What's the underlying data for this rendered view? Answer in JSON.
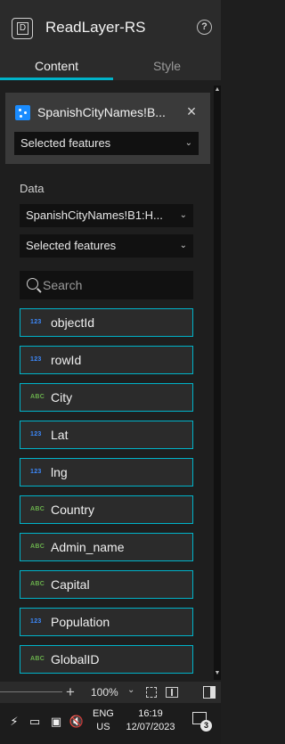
{
  "header": {
    "title": "ReadLayer-RS",
    "logo_letter": "D",
    "help_glyph": "?"
  },
  "tabs": [
    {
      "label": "Content",
      "active": true
    },
    {
      "label": "Style",
      "active": false
    }
  ],
  "layer_card": {
    "name": "SpanishCityNames!B...",
    "close_glyph": "×",
    "selection": "Selected features"
  },
  "data_section": {
    "label": "Data",
    "source": "SpanishCityNames!B1:H...",
    "selection": "Selected features",
    "search_placeholder": "Search"
  },
  "fields": [
    {
      "type": "123",
      "name": "objectId"
    },
    {
      "type": "123",
      "name": "rowId"
    },
    {
      "type": "ABC",
      "name": "City"
    },
    {
      "type": "123",
      "name": "Lat"
    },
    {
      "type": "123",
      "name": "lng"
    },
    {
      "type": "ABC",
      "name": "Country"
    },
    {
      "type": "ABC",
      "name": "Admin_name"
    },
    {
      "type": "ABC",
      "name": "Capital"
    },
    {
      "type": "123",
      "name": "Population"
    },
    {
      "type": "ABC",
      "name": "GlobalID"
    }
  ],
  "zoom": {
    "level": "100%",
    "plus_glyph": "+"
  },
  "taskbar": {
    "lang_line1": "ENG",
    "lang_line2": "US",
    "time": "16:19",
    "date": "12/07/2023",
    "notification_count": "3"
  },
  "colors": {
    "accent": "#00b3c9",
    "numeric_type": "#3d8bff",
    "text_type": "#6ab04c",
    "background": "#1e1e1e",
    "panel": "#2b2b2b"
  }
}
